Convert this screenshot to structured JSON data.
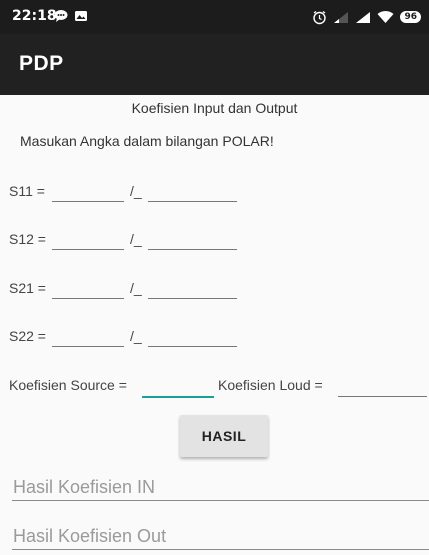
{
  "status": {
    "time": "22:18",
    "battery": "96",
    "icons": [
      "chat-bubble-icon",
      "gallery-icon",
      "alarm-icon",
      "signal-icon",
      "signal-icon",
      "wifi-icon",
      "battery-icon"
    ]
  },
  "app": {
    "title": "PDP"
  },
  "heading": "Koefisien Input dan Output",
  "instruction": "Masukan Angka dalam bilangan POLAR!",
  "params": [
    {
      "label": "S11 =",
      "angle_symbol": "/_",
      "magnitude": "",
      "angle": ""
    },
    {
      "label": "S12 =",
      "angle_symbol": "/_",
      "magnitude": "",
      "angle": ""
    },
    {
      "label": "S21 =",
      "angle_symbol": "/_",
      "magnitude": "",
      "angle": ""
    },
    {
      "label": "S22 =",
      "angle_symbol": "/_",
      "magnitude": "",
      "angle": ""
    }
  ],
  "coef": {
    "source_label": "Koefisien Source =",
    "load_label": "Koefisien Loud =",
    "source_value": "",
    "load_value": ""
  },
  "button": {
    "label": "HASIL"
  },
  "results": {
    "in_placeholder": "Hasil Koefisien IN",
    "out_placeholder": "Hasil Koefisien Out"
  },
  "colors": {
    "accent": "#1a9e9a",
    "app_bar": "#212121",
    "status_bar": "#1c1c1c"
  }
}
